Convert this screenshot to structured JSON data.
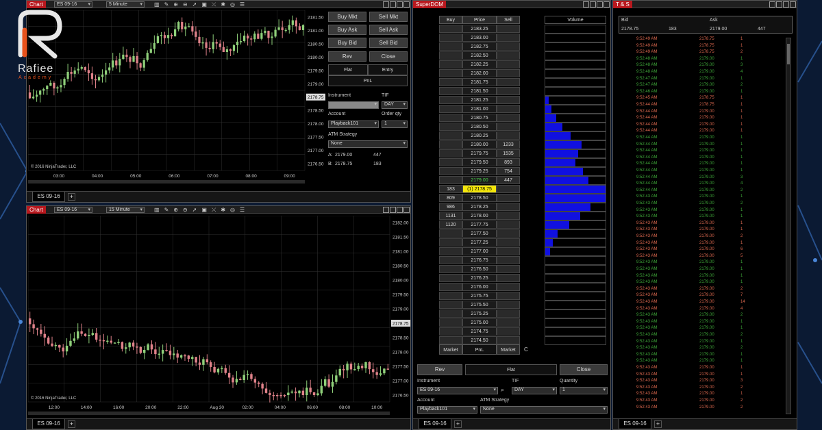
{
  "brand": {
    "name": "Rafiee",
    "sub": "Academy"
  },
  "colors": {
    "up": "#8fd07a",
    "down": "#e0828a",
    "title": "#b8181e",
    "dom_bar": "#1010e0",
    "ts_green": "#3fa93a",
    "ts_red": "#e06a50",
    "highlight": "#f5e70a"
  },
  "chart_top": {
    "title": "Chart",
    "instrument": "ES 09-16",
    "interval": "5 Minute",
    "prices": [
      "2181.50",
      "2181.00",
      "2180.50",
      "2180.00",
      "2179.50",
      "2179.00",
      "2178.75",
      "2178.50",
      "2178.00",
      "2177.50",
      "2177.00",
      "2176.50"
    ],
    "times": [
      "03:00",
      "04:00",
      "05:00",
      "06:00",
      "07:00",
      "08:00",
      "09:00"
    ],
    "copyright": "© 2016 NinjaTrader, LLC",
    "tab": "ES 09-16",
    "last_price": "2178.75"
  },
  "chart_bottom": {
    "title": "Chart",
    "instrument": "ES 09-16",
    "interval": "15 Minute",
    "prices": [
      "2182.00",
      "2181.50",
      "2181.00",
      "2180.50",
      "2180.00",
      "2179.50",
      "2179.00",
      "2178.75",
      "2178.50",
      "2178.00",
      "2177.50",
      "2177.00",
      "2176.50"
    ],
    "times": [
      "12:00",
      "14:00",
      "16:00",
      "20:00",
      "22:00",
      "Aug 30",
      "02:00",
      "04:00",
      "06:00",
      "08:00",
      "10:00"
    ],
    "copyright": "© 2016 NinjaTrader, LLC",
    "tab": "ES 09-16",
    "last_price": "2178.75"
  },
  "order_panel": {
    "buy_mkt": "Buy Mkt",
    "sell_mkt": "Sell Mkt",
    "buy_ask": "Buy Ask",
    "sell_ask": "Sell Ask",
    "buy_bid": "Buy Bid",
    "sell_bid": "Sell Bid",
    "rev": "Rev",
    "close": "Close",
    "flat": "Flat",
    "entry": "Entry",
    "pnl": "PnL",
    "instrument_label": "Instrument",
    "tif_label": "TIF",
    "tif": "DAY",
    "account_label": "Account",
    "account": "Playback101",
    "qty_label": "Order qty",
    "qty": "1",
    "atm_label": "ATM Strategy",
    "atm": "None",
    "ask_label": "A:",
    "ask_price": "2179.00",
    "ask_size": "447",
    "bid_label": "B:",
    "bid_price": "2178.75",
    "bid_size": "183"
  },
  "superdom": {
    "title": "SuperDOM",
    "headers": {
      "buy": "Buy",
      "price": "Price",
      "sell": "Sell",
      "volume": "Volume"
    },
    "rows": [
      {
        "price": "2183.25",
        "buy": "",
        "sell": "",
        "vol": 0
      },
      {
        "price": "2183.00",
        "buy": "",
        "sell": "",
        "vol": 0
      },
      {
        "price": "2182.75",
        "buy": "",
        "sell": "",
        "vol": 0
      },
      {
        "price": "2182.50",
        "buy": "",
        "sell": "",
        "vol": 0
      },
      {
        "price": "2182.25",
        "buy": "",
        "sell": "",
        "vol": 0
      },
      {
        "price": "2182.00",
        "buy": "",
        "sell": "",
        "vol": 0
      },
      {
        "price": "2181.75",
        "buy": "",
        "sell": "",
        "vol": 0
      },
      {
        "price": "2181.50",
        "buy": "",
        "sell": "",
        "vol": 0
      },
      {
        "price": "2181.25",
        "buy": "",
        "sell": "",
        "vol": 0.06
      },
      {
        "price": "2181.00",
        "buy": "",
        "sell": "",
        "vol": 0.1
      },
      {
        "price": "2180.75",
        "buy": "",
        "sell": "",
        "vol": 0.18
      },
      {
        "price": "2180.50",
        "buy": "",
        "sell": "",
        "vol": 0.28
      },
      {
        "price": "2180.25",
        "buy": "",
        "sell": "",
        "vol": 0.42
      },
      {
        "price": "2180.00",
        "buy": "",
        "sell": "1233",
        "vol": 0.6
      },
      {
        "price": "2179.75",
        "buy": "",
        "sell": "1535",
        "vol": 0.55
      },
      {
        "price": "2179.50",
        "buy": "",
        "sell": "893",
        "vol": 0.5
      },
      {
        "price": "2179.25",
        "buy": "",
        "sell": "754",
        "vol": 0.62
      },
      {
        "price": "2179.00",
        "buy": "",
        "sell": "447",
        "vol": 0.72,
        "ask": true
      },
      {
        "price": "(1) 2178.75",
        "buy": "183",
        "sell": "",
        "vol": 1.0,
        "last": true
      },
      {
        "price": "2178.50",
        "buy": "809",
        "sell": "",
        "vol": 1.0
      },
      {
        "price": "2178.25",
        "buy": "986",
        "sell": "",
        "vol": 0.75
      },
      {
        "price": "2178.00",
        "buy": "1131",
        "sell": "",
        "vol": 0.58
      },
      {
        "price": "2177.75",
        "buy": "1120",
        "sell": "",
        "vol": 0.4
      },
      {
        "price": "2177.50",
        "buy": "",
        "sell": "",
        "vol": 0.2
      },
      {
        "price": "2177.25",
        "buy": "",
        "sell": "",
        "vol": 0.12
      },
      {
        "price": "2177.00",
        "buy": "",
        "sell": "",
        "vol": 0.08
      },
      {
        "price": "2176.75",
        "buy": "",
        "sell": "",
        "vol": 0
      },
      {
        "price": "2176.50",
        "buy": "",
        "sell": "",
        "vol": 0
      },
      {
        "price": "2176.25",
        "buy": "",
        "sell": "",
        "vol": 0
      },
      {
        "price": "2176.00",
        "buy": "",
        "sell": "",
        "vol": 0
      },
      {
        "price": "2175.75",
        "buy": "",
        "sell": "",
        "vol": 0
      },
      {
        "price": "2175.50",
        "buy": "",
        "sell": "",
        "vol": 0
      },
      {
        "price": "2175.25",
        "buy": "",
        "sell": "",
        "vol": 0
      },
      {
        "price": "2175.00",
        "buy": "",
        "sell": "",
        "vol": 0
      },
      {
        "price": "2174.75",
        "buy": "",
        "sell": "",
        "vol": 0
      },
      {
        "price": "2174.50",
        "buy": "",
        "sell": "",
        "vol": 0
      }
    ],
    "market_left": "Market",
    "pnl": "PnL",
    "market_right": "Market",
    "c_label": "C",
    "rev": "Rev",
    "flat": "Flat",
    "close": "Close",
    "instrument_label": "Instrument",
    "instrument": "ES 09-16",
    "tif_label": "TIF",
    "tif": "DAY",
    "qty_label": "Quantity",
    "qty": "1",
    "account_label": "Account",
    "account": "Playback101",
    "atm_label": "ATM Strategy",
    "atm": "None",
    "tab": "ES 09-16"
  },
  "ts": {
    "title": "T & S",
    "bid_label": "Bid",
    "ask_label": "Ask",
    "bid": "2178.75",
    "bid_size": "183",
    "ask": "2179.00",
    "ask_size": "447",
    "rows": [
      [
        "9:52:49 AM",
        "2178.75",
        "1",
        "r"
      ],
      [
        "9:52:49 AM",
        "2178.75",
        "1",
        "r"
      ],
      [
        "9:52:49 AM",
        "2178.75",
        "2",
        "r"
      ],
      [
        "9:52:48 AM",
        "2179.00",
        "1",
        "g"
      ],
      [
        "9:52:48 AM",
        "2179.00",
        "3",
        "g"
      ],
      [
        "9:52:48 AM",
        "2179.00",
        "4",
        "g"
      ],
      [
        "9:52:47 AM",
        "2179.00",
        "1",
        "g"
      ],
      [
        "9:52:47 AM",
        "2179.00",
        "2",
        "g"
      ],
      [
        "9:52:46 AM",
        "2179.00",
        "1",
        "g"
      ],
      [
        "9:52:45 AM",
        "2178.75",
        "1",
        "r"
      ],
      [
        "9:52:44 AM",
        "2178.75",
        "1",
        "r"
      ],
      [
        "9:52:44 AM",
        "2179.00",
        "1",
        "r"
      ],
      [
        "9:52:44 AM",
        "2179.00",
        "1",
        "r"
      ],
      [
        "9:52:44 AM",
        "2179.00",
        "1",
        "r"
      ],
      [
        "9:52:44 AM",
        "2179.00",
        "1",
        "r"
      ],
      [
        "9:52:44 AM",
        "2179.00",
        "1",
        "g"
      ],
      [
        "9:52:44 AM",
        "2179.00",
        "1",
        "g"
      ],
      [
        "9:52:44 AM",
        "2179.00",
        "1",
        "g"
      ],
      [
        "9:52:44 AM",
        "2179.00",
        "1",
        "g"
      ],
      [
        "9:52:44 AM",
        "2179.00",
        "1",
        "g"
      ],
      [
        "9:52:44 AM",
        "2179.00",
        "1",
        "g"
      ],
      [
        "9:52:44 AM",
        "2179.00",
        "3",
        "g"
      ],
      [
        "9:52:44 AM",
        "2179.00",
        "4",
        "g"
      ],
      [
        "9:52:44 AM",
        "2179.00",
        "2",
        "g"
      ],
      [
        "9:52:43 AM",
        "2179.00",
        "1",
        "g"
      ],
      [
        "9:52:43 AM",
        "2179.00",
        "2",
        "g"
      ],
      [
        "9:52:43 AM",
        "2179.00",
        "1",
        "g"
      ],
      [
        "9:52:43 AM",
        "2179.00",
        "1",
        "g"
      ],
      [
        "9:52:43 AM",
        "2179.00",
        "1",
        "r"
      ],
      [
        "9:52:43 AM",
        "2179.00",
        "1",
        "r"
      ],
      [
        "9:52:43 AM",
        "2179.00",
        "2",
        "r"
      ],
      [
        "9:52:43 AM",
        "2179.00",
        "1",
        "r"
      ],
      [
        "9:52:43 AM",
        "2179.00",
        "6",
        "r"
      ],
      [
        "9:52:43 AM",
        "2179.00",
        "5",
        "r"
      ],
      [
        "9:52:43 AM",
        "2179.00",
        "1",
        "g"
      ],
      [
        "9:52:43 AM",
        "2179.00",
        "1",
        "g"
      ],
      [
        "9:52:43 AM",
        "2179.00",
        "1",
        "g"
      ],
      [
        "9:52:43 AM",
        "2179.00",
        "1",
        "g"
      ],
      [
        "9:52:43 AM",
        "2179.00",
        "2",
        "r"
      ],
      [
        "9:52:43 AM",
        "2179.00",
        "7",
        "r"
      ],
      [
        "9:52:43 AM",
        "2179.00",
        "14",
        "r"
      ],
      [
        "9:52:43 AM",
        "2179.00",
        "4",
        "r"
      ],
      [
        "9:52:43 AM",
        "2179.00",
        "2",
        "g"
      ],
      [
        "9:52:43 AM",
        "2179.00",
        "1",
        "g"
      ],
      [
        "9:52:43 AM",
        "2179.00",
        "1",
        "g"
      ],
      [
        "9:52:43 AM",
        "2179.00",
        "2",
        "g"
      ],
      [
        "9:52:43 AM",
        "2179.00",
        "1",
        "g"
      ],
      [
        "9:52:43 AM",
        "2179.00",
        "2",
        "g"
      ],
      [
        "9:52:43 AM",
        "2179.00",
        "1",
        "g"
      ],
      [
        "9:52:43 AM",
        "2179.00",
        "1",
        "g"
      ],
      [
        "9:52:43 AM",
        "2179.00",
        "1",
        "r"
      ],
      [
        "9:52:43 AM",
        "2179.00",
        "1",
        "r"
      ],
      [
        "9:52:43 AM",
        "2179.00",
        "3",
        "r"
      ],
      [
        "9:52:43 AM",
        "2179.00",
        "2",
        "r"
      ],
      [
        "9:52:43 AM",
        "2179.00",
        "1",
        "r"
      ],
      [
        "9:52:43 AM",
        "2179.00",
        "2",
        "r"
      ],
      [
        "9:52:43 AM",
        "2179.00",
        "2",
        "r"
      ]
    ],
    "tab": "ES 09-16"
  }
}
